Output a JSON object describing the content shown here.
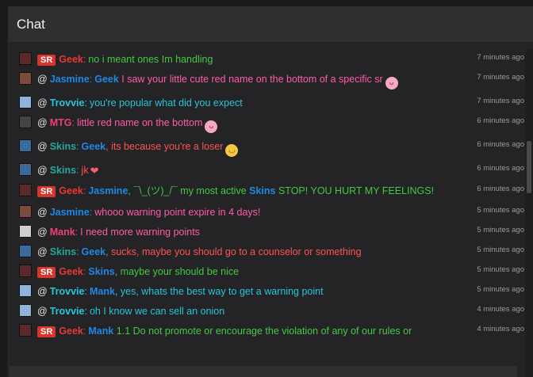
{
  "header": {
    "title": "Chat"
  },
  "colors": {
    "geek": "#e53935",
    "jasmine": "#1e88e5",
    "trovvie": "#26c6da",
    "mtg": "#ec407a",
    "skins": "#26a69a",
    "mank": "#ec407a",
    "green": "#43c943",
    "pink": "#ff5ca8",
    "red": "#ff5252",
    "blue": "#42a5f5"
  },
  "messages": [
    {
      "time": "7 minutes ago",
      "avatar": "geek-avatar",
      "avatar_color": "#5a2a2a",
      "at": false,
      "badge": "SR",
      "user": "Geek",
      "user_color": "#e53935",
      "parts": [
        {
          "text": "no i meant ones Im handling",
          "color": "#43c943"
        }
      ]
    },
    {
      "time": "7 minutes ago",
      "avatar": "jasmine-avatar",
      "avatar_color": "#7a4a3a",
      "at": true,
      "user": "Jasmine",
      "user_color": "#1e88e5",
      "parts": [
        {
          "text": "Geek",
          "color": "#1e88e5",
          "bold": true
        },
        {
          "text": " I saw your little cute red name on the bottom of a specific sr",
          "color": "#ff5ca8"
        }
      ],
      "emoji": "tongue"
    },
    {
      "time": "7 minutes ago",
      "avatar": "trovvie-avatar",
      "avatar_color": "#8fb4d8",
      "at": true,
      "user": "Trovvie",
      "user_color": "#26c6da",
      "parts": [
        {
          "text": "you're popular what did you expect",
          "color": "#26c6da"
        }
      ]
    },
    {
      "time": "6 minutes ago",
      "avatar": "mtg-avatar",
      "avatar_color": "#444444",
      "at": true,
      "user": "MTG",
      "user_color": "#ec407a",
      "parts": [
        {
          "text": "little red name on the bottom",
          "color": "#ff5ca8"
        }
      ],
      "emoji": "tongue"
    },
    {
      "time": "6 minutes ago",
      "avatar": "skins-avatar",
      "avatar_color": "#3a6a9a",
      "at": true,
      "user": "Skins",
      "user_color": "#26a69a",
      "parts": [
        {
          "text": "Geek",
          "color": "#1e88e5",
          "bold": true
        },
        {
          "text": ", its because you're a loser",
          "color": "#ff5252"
        }
      ],
      "emoji": "grin"
    },
    {
      "time": "6 minutes ago",
      "avatar": "skins-avatar",
      "avatar_color": "#3a6a9a",
      "at": true,
      "user": "Skins",
      "user_color": "#26a69a",
      "parts": [
        {
          "text": "jk",
          "color": "#ff5252"
        }
      ],
      "emoji": "heart"
    },
    {
      "time": "6 minutes ago",
      "avatar": "geek-avatar",
      "avatar_color": "#5a2a2a",
      "at": false,
      "badge": "SR",
      "user": "Geek",
      "user_color": "#e53935",
      "parts": [
        {
          "text": "Jasmine",
          "color": "#1e88e5",
          "bold": true
        },
        {
          "text": ", ¯\\_(ツ)_/¯ my most active ",
          "color": "#43c943"
        },
        {
          "text": "Skins",
          "color": "#1e88e5",
          "bold": true
        },
        {
          "text": " STOP! YOU HURT MY FEELINGS!",
          "color": "#43c943"
        }
      ]
    },
    {
      "time": "5 minutes ago",
      "avatar": "jasmine-avatar",
      "avatar_color": "#7a4a3a",
      "at": true,
      "user": "Jasmine",
      "user_color": "#1e88e5",
      "parts": [
        {
          "text": "whooo warning point expire in 4 days!",
          "color": "#ff5ca8"
        }
      ]
    },
    {
      "time": "5 minutes ago",
      "avatar": "mank-avatar",
      "avatar_color": "#cfcfcf",
      "at": true,
      "user": "Mank",
      "user_color": "#ec407a",
      "parts": [
        {
          "text": "I need more warning points",
          "color": "#ff5ca8"
        }
      ]
    },
    {
      "time": "5 minutes ago",
      "avatar": "skins-avatar",
      "avatar_color": "#3a6a9a",
      "at": true,
      "user": "Skins",
      "user_color": "#26a69a",
      "parts": [
        {
          "text": "Geek",
          "color": "#1e88e5",
          "bold": true
        },
        {
          "text": ", sucks, maybe you should go to a counselor or something",
          "color": "#ff5252"
        }
      ]
    },
    {
      "time": "5 minutes ago",
      "avatar": "geek-avatar",
      "avatar_color": "#5a2a2a",
      "at": false,
      "badge": "SR",
      "user": "Geek",
      "user_color": "#e53935",
      "parts": [
        {
          "text": "Skins",
          "color": "#1e88e5",
          "bold": true
        },
        {
          "text": ", maybe your should be nice",
          "color": "#43c943"
        }
      ]
    },
    {
      "time": "5 minutes ago",
      "avatar": "trovvie-avatar",
      "avatar_color": "#8fb4d8",
      "at": true,
      "user": "Trovvie",
      "user_color": "#26c6da",
      "parts": [
        {
          "text": "Mank",
          "color": "#1e88e5",
          "bold": true
        },
        {
          "text": ", yes, whats the best way to get a warning point",
          "color": "#26c6da"
        }
      ]
    },
    {
      "time": "4 minutes ago",
      "avatar": "trovvie-avatar",
      "avatar_color": "#8fb4d8",
      "at": true,
      "user": "Trovvie",
      "user_color": "#26c6da",
      "parts": [
        {
          "text": "oh I know we can sell an onion",
          "color": "#26c6da"
        }
      ]
    },
    {
      "time": "4 minutes ago",
      "avatar": "geek-avatar",
      "avatar_color": "#5a2a2a",
      "at": false,
      "badge": "SR",
      "user": "Geek",
      "user_color": "#e53935",
      "parts": [
        {
          "text": "Mank",
          "color": "#1e88e5",
          "bold": true
        },
        {
          "text": " 1.1 Do not promote or encourage the violation of any of our rules or",
          "color": "#43c943"
        }
      ]
    }
  ]
}
